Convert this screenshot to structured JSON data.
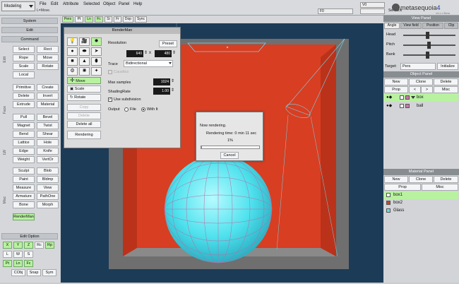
{
  "toolbar": {
    "mode": "Modeling",
    "status": "L=Move.",
    "menus": [
      "File",
      "Edit",
      "Attribute",
      "Selected",
      "Object",
      "Panel",
      "Help"
    ],
    "fields": [
      "F0",
      "V0",
      "",
      "Sel Lock"
    ]
  },
  "logo": {
    "name": "metasequoia",
    "ver": "4",
    "sub": "v4.x.x Beta"
  },
  "left": {
    "system": "System",
    "edit": "Edit",
    "command": "Command",
    "groups": [
      "Edit",
      "Face",
      "LW",
      "Misc"
    ],
    "buttons": [
      [
        "Select",
        "Rect"
      ],
      [
        "Rope",
        "Move"
      ],
      [
        "Scale",
        "Rotate"
      ],
      [
        "Local",
        ""
      ],
      [
        "Primitive",
        "Create"
      ],
      [
        "Delete",
        "Invert"
      ],
      [
        "Extrude",
        "Material"
      ],
      [
        "Pull",
        "Bevel"
      ],
      [
        "Magnet",
        "Twist"
      ],
      [
        "Bend",
        "Shear"
      ],
      [
        "Lattice",
        "Hole"
      ],
      [
        "Edge",
        "Knife"
      ],
      [
        "Weight",
        "VertOr"
      ],
      [
        "Sculpt",
        "Blob"
      ],
      [
        "Paint",
        "Bldmp"
      ],
      [
        "Measure",
        "View"
      ],
      [
        "Armature",
        "PathOne"
      ],
      [
        "Bone",
        "Morph"
      ],
      [
        "RenderMan",
        ""
      ]
    ],
    "editoption": "Edit Option",
    "opt1": [
      "X",
      "Y",
      "Z",
      "Rc",
      "Rp"
    ],
    "opt2": [
      "L",
      "W",
      "S"
    ],
    "opt3": [
      "Pt",
      "Ln",
      "Fc"
    ],
    "opt4": [
      "CObj",
      "Snap",
      "Sym"
    ]
  },
  "viewtabs": [
    "Pers",
    "Pt",
    "Ln",
    "Fc",
    "Si",
    "Fr",
    "Dop",
    "Sync"
  ],
  "rightpanel": {
    "view": "View Panel",
    "viewtabs": [
      "Angle",
      "View field",
      "Position",
      "Clip"
    ],
    "sliders": [
      "Head",
      "Pitch",
      "Bank"
    ],
    "target_label": "Target:",
    "target": "Pers",
    "initialize": "Initialize",
    "object": "Object Panel",
    "obj_btns": [
      "New",
      "Clone",
      "Delete"
    ],
    "obj_btns2": [
      "Prop",
      "<",
      ">",
      "Misc"
    ],
    "objects": [
      "box",
      "ball"
    ],
    "material": "Material Panel",
    "mat_btns": [
      "New",
      "Clone",
      "Delete"
    ],
    "mat_btns2": [
      "Prop",
      "Misc"
    ],
    "materials": [
      {
        "name": "box1",
        "color": "#ffffff"
      },
      {
        "name": "box2",
        "color": "#d44020"
      },
      {
        "name": "Glass",
        "color": "#62e0f0"
      }
    ]
  },
  "renderman": {
    "title": "RenderMan",
    "resolution": "Resolution",
    "preset": "Preset",
    "w": "640",
    "x": "x",
    "h": "480",
    "trace_label": "Trace",
    "trace": "Bidirectional",
    "caustics": "Caustics",
    "maxsamples_label": "Max samples",
    "maxsamples": "1024",
    "shading_label": "ShadingRate",
    "shading": "1.00",
    "subdiv": "Use subdivision",
    "output": "Output",
    "file": "File",
    "with": "With It",
    "move": "Move",
    "scale": "Scale",
    "rotate": "Rotate",
    "copy": "Copy",
    "delete": "Delete",
    "delete_all": "Delete all",
    "rendering": "Rendering"
  },
  "now": {
    "title": "Now rendering.",
    "time": "Rendering time: 0 min 11 sec",
    "pct": "1%",
    "progress": 0.01,
    "cancel": "Cancel"
  }
}
